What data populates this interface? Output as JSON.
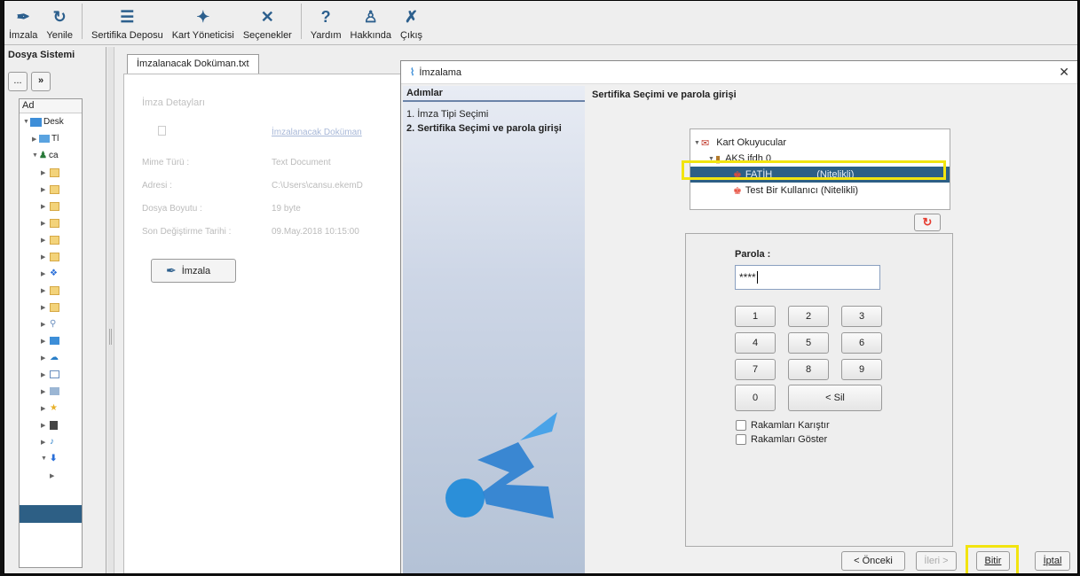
{
  "toolbar": {
    "items": [
      {
        "label": "İmzala",
        "icon": "sign-pen-icon"
      },
      {
        "label": "Yenile",
        "icon": "refresh-icon"
      },
      {
        "label": "Sertifika Deposu",
        "icon": "certificate-store-icon"
      },
      {
        "label": "Kart Yöneticisi",
        "icon": "card-manager-icon"
      },
      {
        "label": "Seçenekler",
        "icon": "tools-icon"
      },
      {
        "label": "Yardım",
        "icon": "help-icon"
      },
      {
        "label": "Hakkında",
        "icon": "about-icon"
      },
      {
        "label": "Çıkış",
        "icon": "exit-icon"
      }
    ]
  },
  "left_panel": {
    "title": "Dosya Sistemi",
    "back_button": "...",
    "forward_button": "»",
    "tree_header": "Ad",
    "tree_items": [
      "Desk",
      "Tl",
      "ca"
    ]
  },
  "document": {
    "tab_label": "İmzalanacak Doküman.txt",
    "details_title": "İmza Detayları",
    "file_link": "İmzalanacak Doküman",
    "mime_label": "Mime Türü :",
    "mime_value": "Text Document",
    "address_label": "Adresi :",
    "address_value": "C:\\Users\\cansu.ekemD",
    "size_label": "Dosya Boyutu :",
    "size_value": "19 byte",
    "modified_label": "Son Değiştirme Tarihi :",
    "modified_value": "09.May.2018 10:15:00",
    "sign_button": "İmzala"
  },
  "dialog": {
    "title": "İmzalama",
    "steps_header": "Adımlar",
    "steps": [
      "1. İmza Tipi Seçimi",
      "2. Sertifika Seçimi ve parola girişi"
    ],
    "content_title": "Sertifika Seçimi ve parola girişi",
    "cert_tree": {
      "root": "Kart Okuyucular",
      "reader": "AKS ifdh 0",
      "selected_cert_name": "FATİH",
      "selected_cert_type": "(Nitelikli)",
      "other_cert": "Test Bir Kullanıcı (Nitelikli)"
    },
    "password_label": "Parola :",
    "password_value": "****",
    "keypad": [
      "1",
      "2",
      "3",
      "4",
      "5",
      "6",
      "7",
      "8",
      "9",
      "0",
      "< Sil"
    ],
    "mix_digits_label": "Rakamları Karıştır",
    "show_digits_label": "Rakamları Göster",
    "buttons": {
      "prev": "< Önceki",
      "next": "İleri >",
      "finish": "Bitir",
      "cancel": "İptal"
    }
  },
  "colors": {
    "accent": "#2d5f85",
    "highlight": "#f2e40f",
    "steps_header_line": "#6b83a8"
  }
}
